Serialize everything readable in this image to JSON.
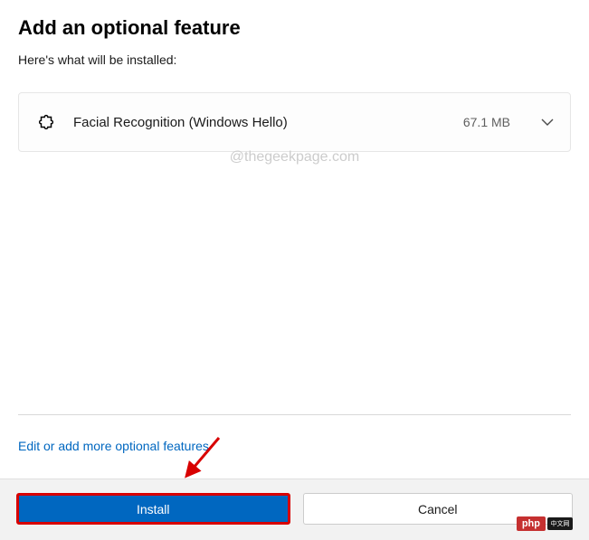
{
  "dialog": {
    "title": "Add an optional feature",
    "subtitle": "Here's what will be installed:"
  },
  "features": [
    {
      "name": "Facial Recognition (Windows Hello)",
      "size": "67.1 MB"
    }
  ],
  "watermark": "@thegeekpage.com",
  "link": {
    "edit_features": "Edit or add more optional features"
  },
  "buttons": {
    "install": "Install",
    "cancel": "Cancel"
  },
  "badge": {
    "php": "php",
    "tail": "中文网"
  }
}
